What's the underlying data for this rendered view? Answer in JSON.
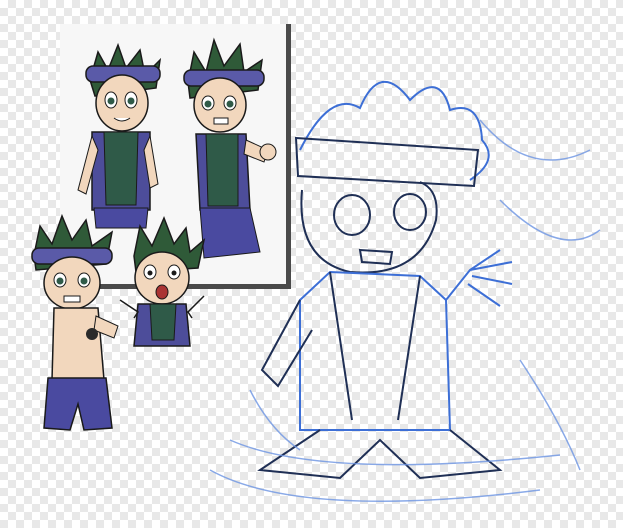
{
  "artwork": {
    "colors": {
      "background_check": "#e8e8e8",
      "panel": "#f7f7f7",
      "panel_border": "#4a4a4a",
      "headband": "#5a5aa8",
      "vest": "#4d4d9a",
      "hair": "#2f5a38",
      "shirt": "#2f5a48",
      "skin": "#f2d7bd",
      "shorts": "#4a4aa0",
      "sketch_blue": "#3d6fd6",
      "sketch_dark": "#1f2f55"
    }
  }
}
